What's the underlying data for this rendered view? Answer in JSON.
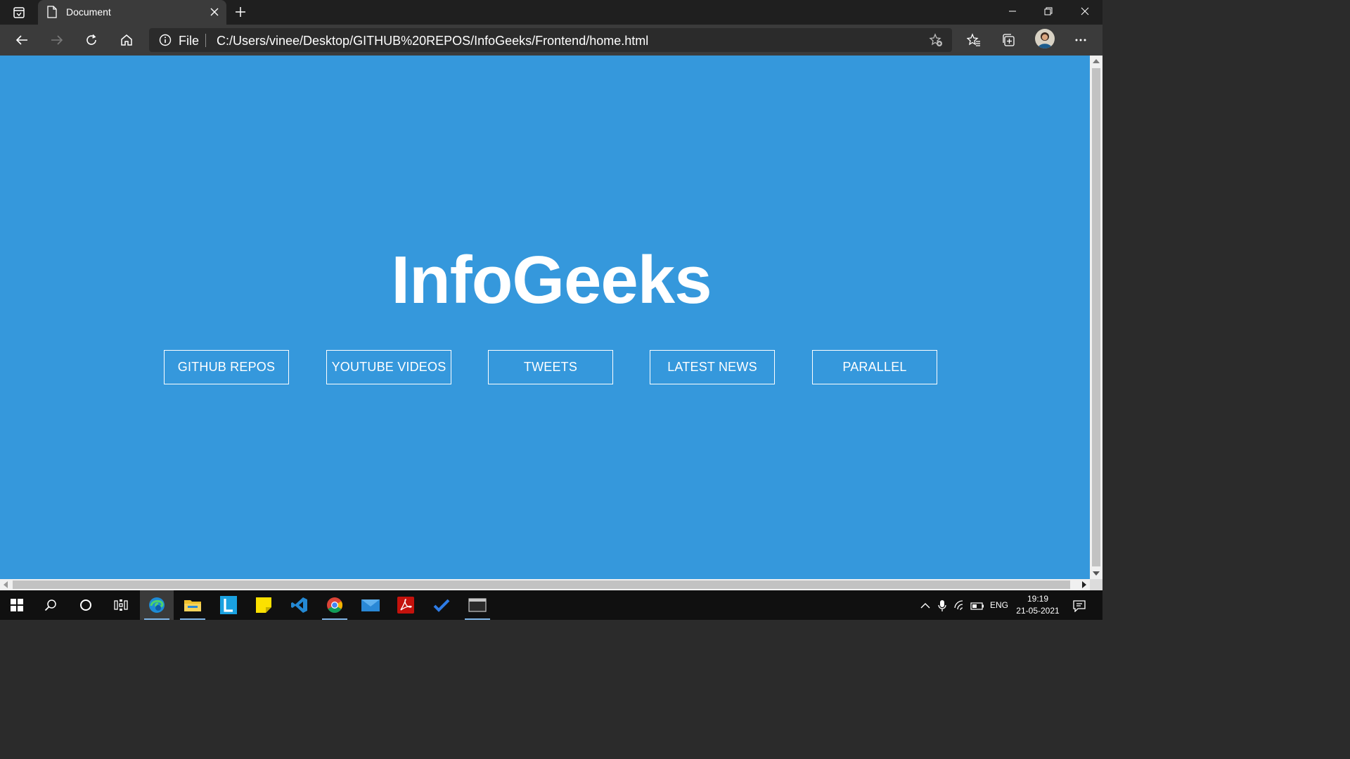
{
  "browser": {
    "tab": {
      "title": "Document"
    },
    "address": {
      "scheme": "File",
      "url": "C:/Users/vinee/Desktop/GITHUB%20REPOS/InfoGeeks/Frontend/home.html"
    }
  },
  "page": {
    "title": "InfoGeeks",
    "buttons": [
      "GITHUB REPOS",
      "YOUTUBE VIDEOS",
      "TWEETS",
      "LATEST NEWS",
      "PARALLEL"
    ],
    "background_color": "#3598dc"
  },
  "taskbar": {
    "apps": [
      "start-icon",
      "search-icon",
      "cortana-icon",
      "task-view-icon",
      "edge-icon",
      "file-explorer-icon",
      "letters-app-icon",
      "sticky-notes-icon",
      "vscode-icon",
      "chrome-icon",
      "mail-icon",
      "acrobat-icon",
      "todo-icon",
      "terminal-icon"
    ],
    "language": "ENG",
    "time": "19:19",
    "date": "21-05-2021"
  }
}
